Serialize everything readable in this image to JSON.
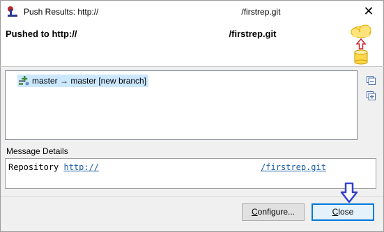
{
  "window": {
    "title_prefix": "Push Results: http://",
    "title_suffix": "/firstrep.git",
    "close_glyph": "✕"
  },
  "header": {
    "title_prefix": "Pushed to http://",
    "title_suffix": "/firstrep.git",
    "banner_icon": "cloud-push-database-icon"
  },
  "tree": {
    "rows": [
      {
        "icon": "branch-add-icon",
        "label": "master → master [new branch]"
      }
    ],
    "collapse_icon": "collapse-all-icon",
    "expand_icon": "expand-all-icon"
  },
  "message": {
    "section_label": "Message Details",
    "prefix": "Repository ",
    "link_prefix": "http://",
    "link_suffix": "/firstrep.git"
  },
  "buttons": {
    "configure": {
      "accesskey": "C",
      "rest": "onfigure..."
    },
    "close": {
      "accesskey": "C",
      "rest": "lose"
    }
  },
  "annotation": {
    "arrow_icon": "down-arrow-icon",
    "arrow_color": "#3340cc"
  },
  "colors": {
    "selection": "#cce8ff",
    "link": "#1a5ca8",
    "default_button_border": "#0078d7"
  }
}
